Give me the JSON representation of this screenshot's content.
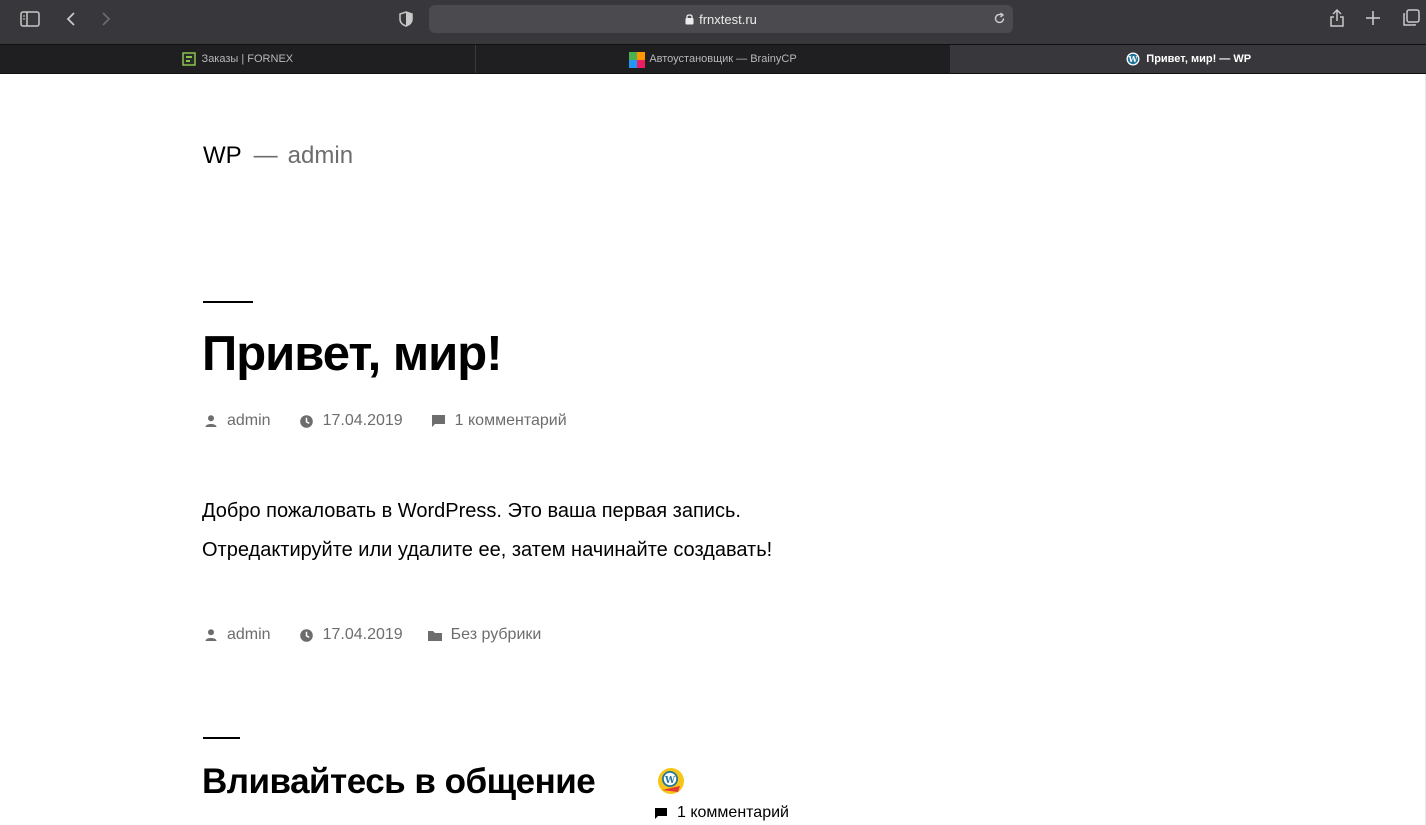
{
  "browser": {
    "url": "frnxtest.ru",
    "tabs": [
      {
        "title": "Заказы | FORNEX",
        "active": false
      },
      {
        "title": "Автоустановщик — BrainyCP",
        "active": false
      },
      {
        "title": "Привет, мир! — WP",
        "active": true
      }
    ]
  },
  "site": {
    "title": "WP",
    "separator": "—",
    "description": "admin"
  },
  "post": {
    "title": "Привет, мир!",
    "author": "admin",
    "date": "17.04.2019",
    "comments_link": "1 комментарий",
    "content_line1": "Добро пожаловать в WordPress. Это ваша первая запись.",
    "content_line2": "Отредактируйте или удалите ее, затем начинайте создавать!",
    "footer_author": "admin",
    "footer_date": "17.04.2019",
    "category": "Без рубрики"
  },
  "comments": {
    "title": "Вливайтесь в общение",
    "count_label": "1 комментарий"
  },
  "colors": {
    "toolbar": "#38373b",
    "tabbar": "#1f1f21",
    "meta_gray": "#6d6d6d"
  }
}
